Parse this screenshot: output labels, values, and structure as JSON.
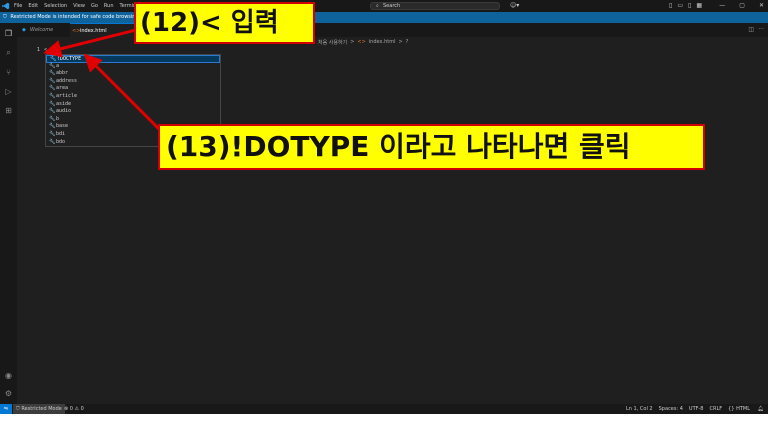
{
  "titlebar": {
    "menu": [
      "File",
      "Edit",
      "Selection",
      "View",
      "Go",
      "Run",
      "Termin"
    ],
    "search_placeholder": "Search"
  },
  "banner": {
    "text": "Restricted Mode is intended for safe code browsing. Trust"
  },
  "tabs": [
    {
      "label": "Welcome"
    },
    {
      "label": "index.html"
    }
  ],
  "breadcrumb": {
    "folder": "처음 사용하기",
    "sep": ">",
    "file": "index.html",
    "symbol": "?"
  },
  "editor": {
    "line_number": "1",
    "typed_text": "<"
  },
  "suggestions": [
    "!DOCTYPE",
    "a",
    "abbr",
    "address",
    "area",
    "article",
    "aside",
    "audio",
    "b",
    "base",
    "bdi",
    "bdo"
  ],
  "statusbar": {
    "restricted": "Restricted Mode",
    "problems": "⊗ 0 ⚠ 0",
    "position": "Ln 1, Col 2",
    "spaces": "Spaces: 4",
    "encoding": "UTF-8",
    "eol": "CRLF",
    "language": "HTML"
  },
  "annotations": {
    "step12": "(12)< 입력",
    "step13": "(13)!DOTYPE 이라고 나타나면 클릭"
  },
  "colors": {
    "callout_bg": "#ffff00",
    "callout_border": "#d00000",
    "arrow": "#e00000",
    "accent": "#0078d4"
  },
  "icons": [
    "vscode-logo-icon",
    "search-icon",
    "copilot-icon",
    "explorer-icon",
    "source-control-icon",
    "run-debug-icon",
    "extensions-icon",
    "account-icon",
    "settings-icon",
    "wrench-icon",
    "html-file-icon",
    "shield-icon"
  ]
}
